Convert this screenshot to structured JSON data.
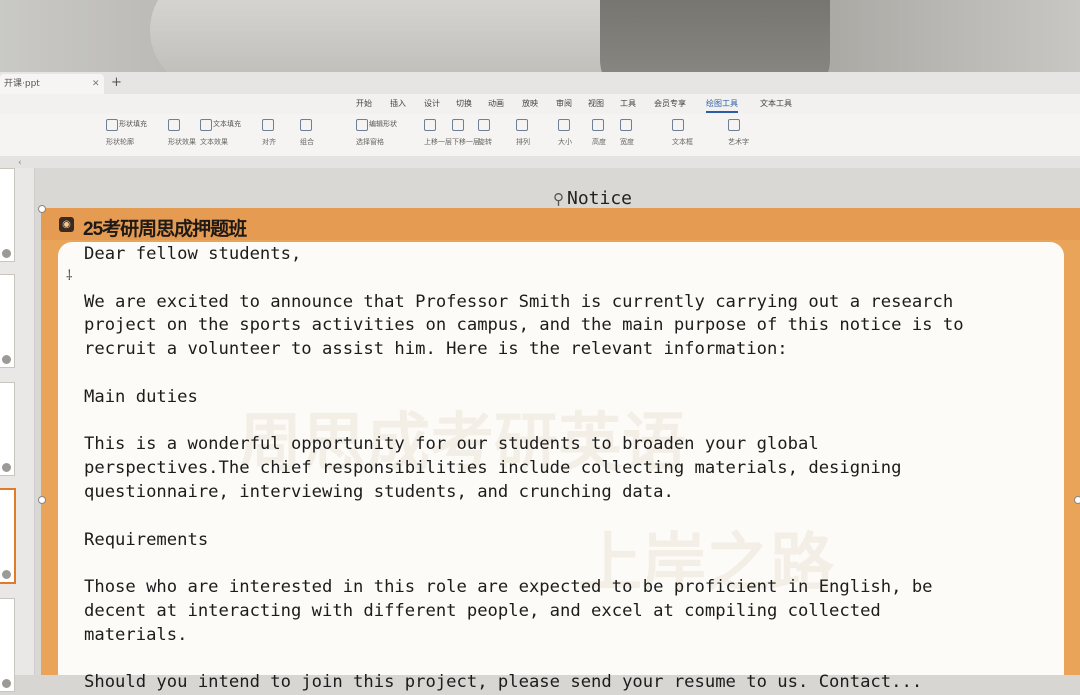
{
  "app": {
    "tab_title": "开课·ppt",
    "menu": [
      "开始",
      "插入",
      "设计",
      "切换",
      "动画",
      "放映",
      "审阅",
      "视图",
      "工具",
      "会员专享",
      "绘图工具",
      "文本工具"
    ],
    "active_menu_index": 10
  },
  "ribbon": {
    "groups": [
      {
        "l1": "形状填充",
        "l2": "形状轮廓"
      },
      {
        "l1": "",
        "l2": "形状效果"
      },
      {
        "l1": "文本填充",
        "l2": "文本效果"
      },
      {
        "l1": "",
        "l2": "对齐"
      },
      {
        "l1": "",
        "l2": "组合"
      },
      {
        "l1": "编辑形状",
        "l2": "选择窗格"
      },
      {
        "l1": "",
        "l2": "上移一层"
      },
      {
        "l1": "",
        "l2": "下移一层"
      },
      {
        "l1": "",
        "l2": "旋转"
      },
      {
        "l1": "",
        "l2": "排列"
      },
      {
        "l1": "",
        "l2": "大小"
      },
      {
        "l1": "",
        "l2": "高度"
      },
      {
        "l1": "",
        "l2": "宽度"
      },
      {
        "l1": "",
        "l2": "文本框"
      },
      {
        "l1": "",
        "l2": "艺术字"
      }
    ]
  },
  "slide": {
    "title": "25考研周思成押题班",
    "notice_label": "Notice",
    "watermarks": [
      "周思成考研英语",
      "上岸之路"
    ],
    "body": [
      "Dear fellow students,",
      "",
      "We are excited to announce that Professor Smith is currently carrying out a research",
      "project on the sports activities on campus, and the main purpose of this notice is to",
      "recruit a volunteer to assist him. Here is the relevant information:",
      "",
      "Main duties",
      "",
      "This is a wonderful opportunity for our students to broaden your global",
      "perspectives.The chief responsibilities include collecting materials, designing",
      "questionnaire, interviewing students, and crunching data.",
      "",
      "Requirements",
      "",
      "Those who are interested in this role are expected to be proficient in English, be",
      "decent at interacting with different people, and excel at compiling collected",
      "materials.",
      "",
      "Should you intend to join this project, please send your resume to us. Contact..."
    ]
  },
  "colors": {
    "slide_orange": "#eaa45a",
    "card_bg": "#fdfbf7",
    "active_menu": "#2c5ea8"
  }
}
